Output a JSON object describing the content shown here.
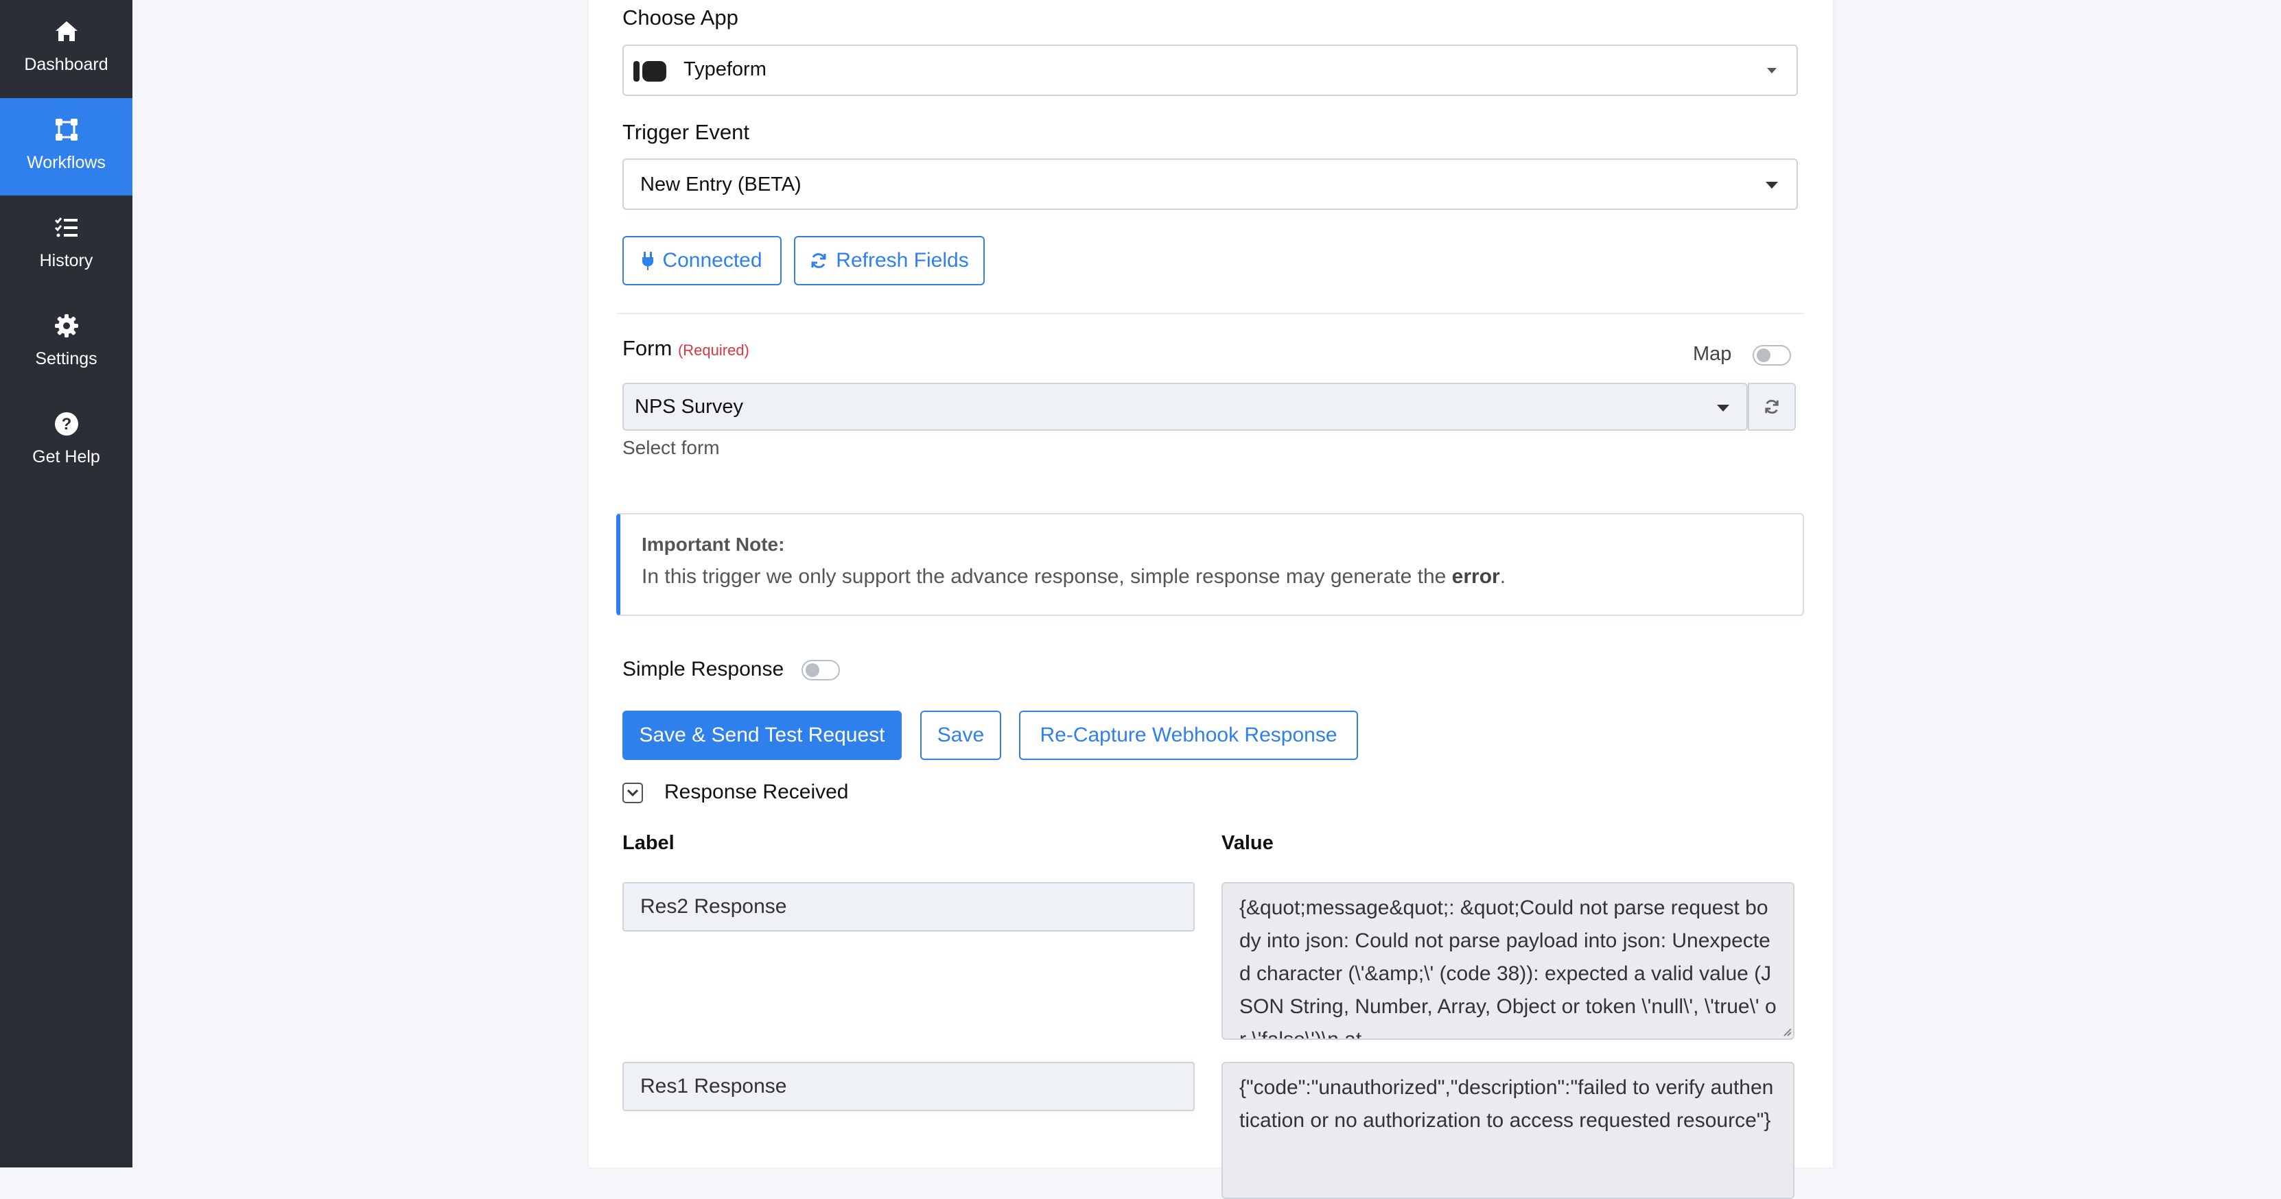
{
  "sidebar": {
    "items": [
      {
        "label": "Dashboard",
        "icon": "home-icon",
        "active": false
      },
      {
        "label": "Workflows",
        "icon": "workflow-icon",
        "active": true
      },
      {
        "label": "History",
        "icon": "list-check-icon",
        "active": false
      },
      {
        "label": "Settings",
        "icon": "gear-icon",
        "active": false
      },
      {
        "label": "Get Help",
        "icon": "question-icon",
        "active": false
      }
    ]
  },
  "form": {
    "choose_app_label": "Choose App",
    "app_value": "Typeform",
    "trigger_event_label": "Trigger Event",
    "trigger_event_value": "New Entry (BETA)",
    "connected_label": "Connected",
    "refresh_fields_label": "Refresh Fields",
    "form_label": "Form",
    "required_label": "(Required)",
    "map_label": "Map",
    "form_value": "NPS Survey",
    "form_help": "Select form",
    "note_title": "Important Note:",
    "note_text_before": "In this trigger we only support the advance response, simple response may generate the ",
    "note_text_bold": "error",
    "note_text_after": ".",
    "simple_response_label": "Simple Response",
    "save_send_label": "Save & Send Test Request",
    "save_label": "Save",
    "recapture_label": "Re-Capture Webhook Response",
    "response_received_label": "Response Received",
    "col_label": "Label",
    "col_value": "Value",
    "rows": [
      {
        "label": "Res2 Response",
        "value": "{&quot;message&quot;: &quot;Could not parse request body into json: Could not parse payload into json: Unexpected character (\\'&amp;\\' (code 38)): expected a valid value (JSON String, Number, Array, Object or token \\'null\\', \\'true\\' or \\'false\\')\\n at"
      },
      {
        "label": "Res1 Response",
        "value": "{\"code\":\"unauthorized\",\"description\":\"failed to verify authentication or no authorization to access requested resource\"}"
      }
    ]
  },
  "colors": {
    "sidebar_bg": "#2a2f36",
    "accent": "#2f80ed",
    "required": "#d9363e"
  }
}
